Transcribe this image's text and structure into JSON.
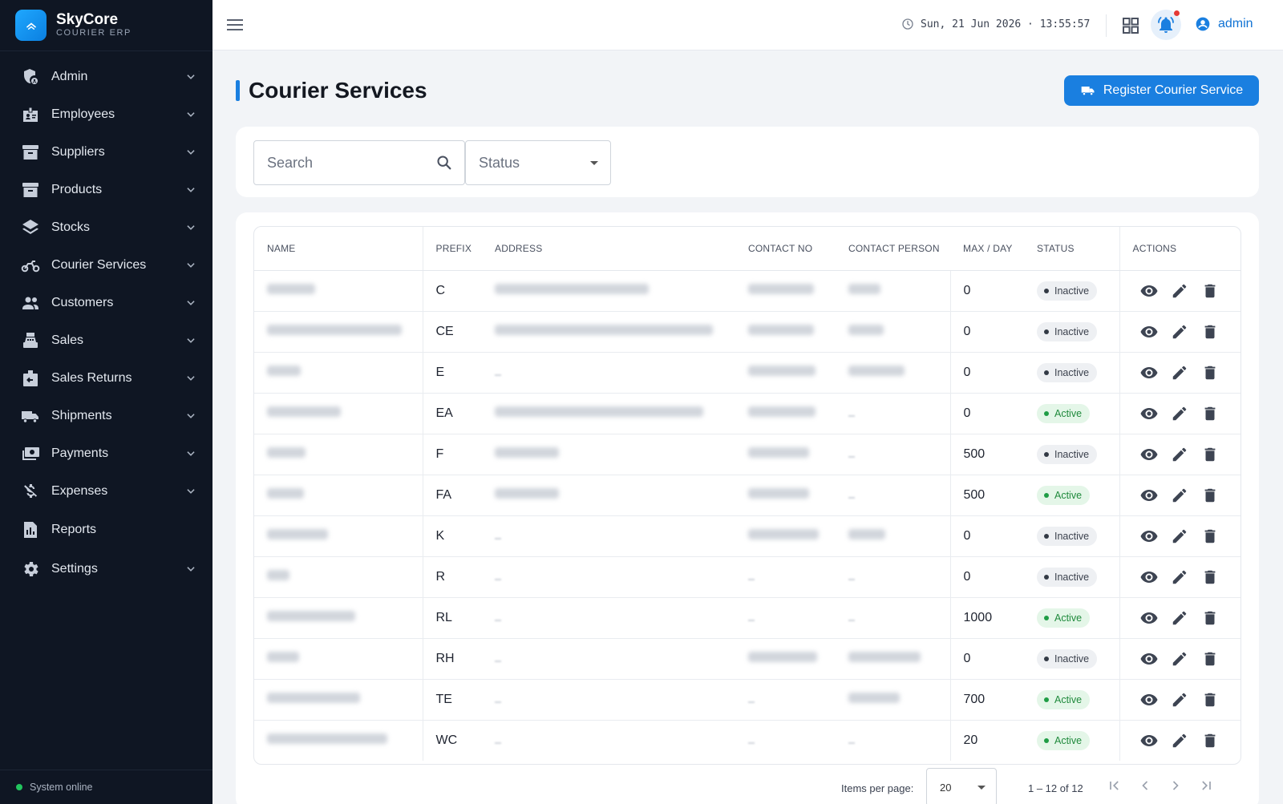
{
  "app": {
    "name": "SkyCore",
    "subtitle": "COURIER ERP"
  },
  "sidebar": {
    "items": [
      {
        "label": "Admin",
        "icon": "admin-shield-icon",
        "has_children": true
      },
      {
        "label": "Employees",
        "icon": "badge-icon",
        "has_children": true
      },
      {
        "label": "Suppliers",
        "icon": "inventory-box-icon",
        "has_children": true
      },
      {
        "label": "Products",
        "icon": "inventory-box-icon",
        "has_children": true
      },
      {
        "label": "Stocks",
        "icon": "layers-icon",
        "has_children": true
      },
      {
        "label": "Courier Services",
        "icon": "motorbike-icon",
        "has_children": true
      },
      {
        "label": "Customers",
        "icon": "people-icon",
        "has_children": true
      },
      {
        "label": "Sales",
        "icon": "cash-register-icon",
        "has_children": true
      },
      {
        "label": "Sales Returns",
        "icon": "return-box-icon",
        "has_children": true
      },
      {
        "label": "Shipments",
        "icon": "truck-icon",
        "has_children": true
      },
      {
        "label": "Payments",
        "icon": "payments-icon",
        "has_children": true
      },
      {
        "label": "Expenses",
        "icon": "money-off-icon",
        "has_children": true
      },
      {
        "label": "Reports",
        "icon": "report-icon",
        "has_children": false
      },
      {
        "label": "Settings",
        "icon": "gear-icon",
        "has_children": true
      }
    ],
    "status_text": "System online"
  },
  "topbar": {
    "datetime": "Sun, 21 Jun 2026 · 13:55:57",
    "username": "admin"
  },
  "page": {
    "title": "Courier Services",
    "register_button": "Register Courier Service"
  },
  "filters": {
    "search_placeholder": "Search",
    "status_placeholder": "Status"
  },
  "table": {
    "columns": [
      "NAME",
      "PREFIX",
      "ADDRESS",
      "CONTACT NO",
      "CONTACT PERSON",
      "MAX / DAY",
      "STATUS",
      "ACTIONS"
    ],
    "rows": [
      {
        "prefix": "C",
        "max": "0",
        "status": "Inactive"
      },
      {
        "prefix": "CE",
        "max": "0",
        "status": "Inactive"
      },
      {
        "prefix": "E",
        "max": "0",
        "status": "Inactive"
      },
      {
        "prefix": "EA",
        "max": "0",
        "status": "Active"
      },
      {
        "prefix": "F",
        "max": "500",
        "status": "Inactive"
      },
      {
        "prefix": "FA",
        "max": "500",
        "status": "Active"
      },
      {
        "prefix": "K",
        "max": "0",
        "status": "Inactive"
      },
      {
        "prefix": "R",
        "max": "0",
        "status": "Inactive"
      },
      {
        "prefix": "RL",
        "max": "1000",
        "status": "Active"
      },
      {
        "prefix": "RH",
        "max": "0",
        "status": "Inactive"
      },
      {
        "prefix": "TE",
        "max": "700",
        "status": "Active"
      },
      {
        "prefix": "WC",
        "max": "20",
        "status": "Active"
      }
    ]
  },
  "paginator": {
    "items_per_page_label": "Items per page:",
    "items_per_page_value": "20",
    "range_label": "1 – 12 of 12"
  },
  "colors": {
    "sidebar_bg": "#0f1623",
    "accent": "#1a7fe0",
    "active_green": "#1f8a3c",
    "notification_red": "#e53935"
  }
}
